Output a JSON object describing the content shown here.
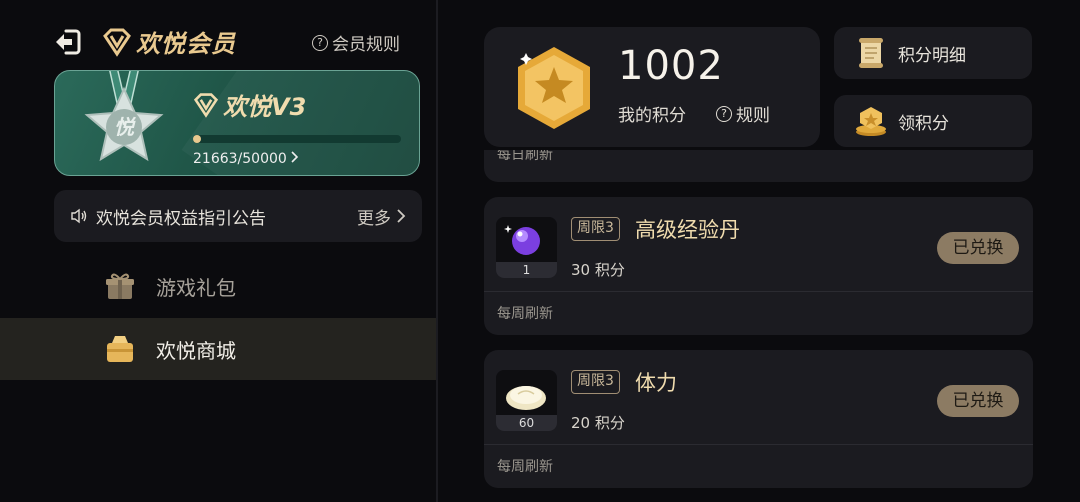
{
  "header": {
    "title": "欢悦会员",
    "rules_label": "会员规则",
    "back_icon": "back-arrow-icon",
    "logo_icon": "brand-diamond-icon"
  },
  "level_card": {
    "level_name": "欢悦V3",
    "medal_char": "悦",
    "progress_text": "21663/50000",
    "progress_fraction": 0.04
  },
  "notice": {
    "text": "欢悦会员权益指引公告",
    "more_label": "更多"
  },
  "nav": {
    "items": [
      {
        "label": "游戏礼包",
        "icon": "gift-box-icon",
        "selected": false
      },
      {
        "label": "欢悦商城",
        "icon": "shop-bag-icon",
        "selected": true
      }
    ]
  },
  "points": {
    "value": "1002",
    "label": "我的积分",
    "rules_label": "规则"
  },
  "side_buttons": {
    "detail_label": "积分明细",
    "earn_label": "领积分"
  },
  "partial_card": {
    "refresh_text": "每日刷新"
  },
  "items": [
    {
      "limit_tag": "周限3",
      "name": "高级经验丹",
      "cost": "30 积分",
      "quantity": "1",
      "button_label": "已兑换",
      "refresh_text": "每周刷新",
      "icon": "purple-orb-icon"
    },
    {
      "limit_tag": "周限3",
      "name": "体力",
      "cost": "20 积分",
      "quantity": "60",
      "button_label": "已兑换",
      "refresh_text": "每周刷新",
      "icon": "steamed-bun-icon"
    }
  ],
  "colors": {
    "accent_gold": "#e9c98f",
    "card_bg": "#1b1b20",
    "level_card_green": "#1f5547",
    "button_bg": "#8c7b63"
  }
}
